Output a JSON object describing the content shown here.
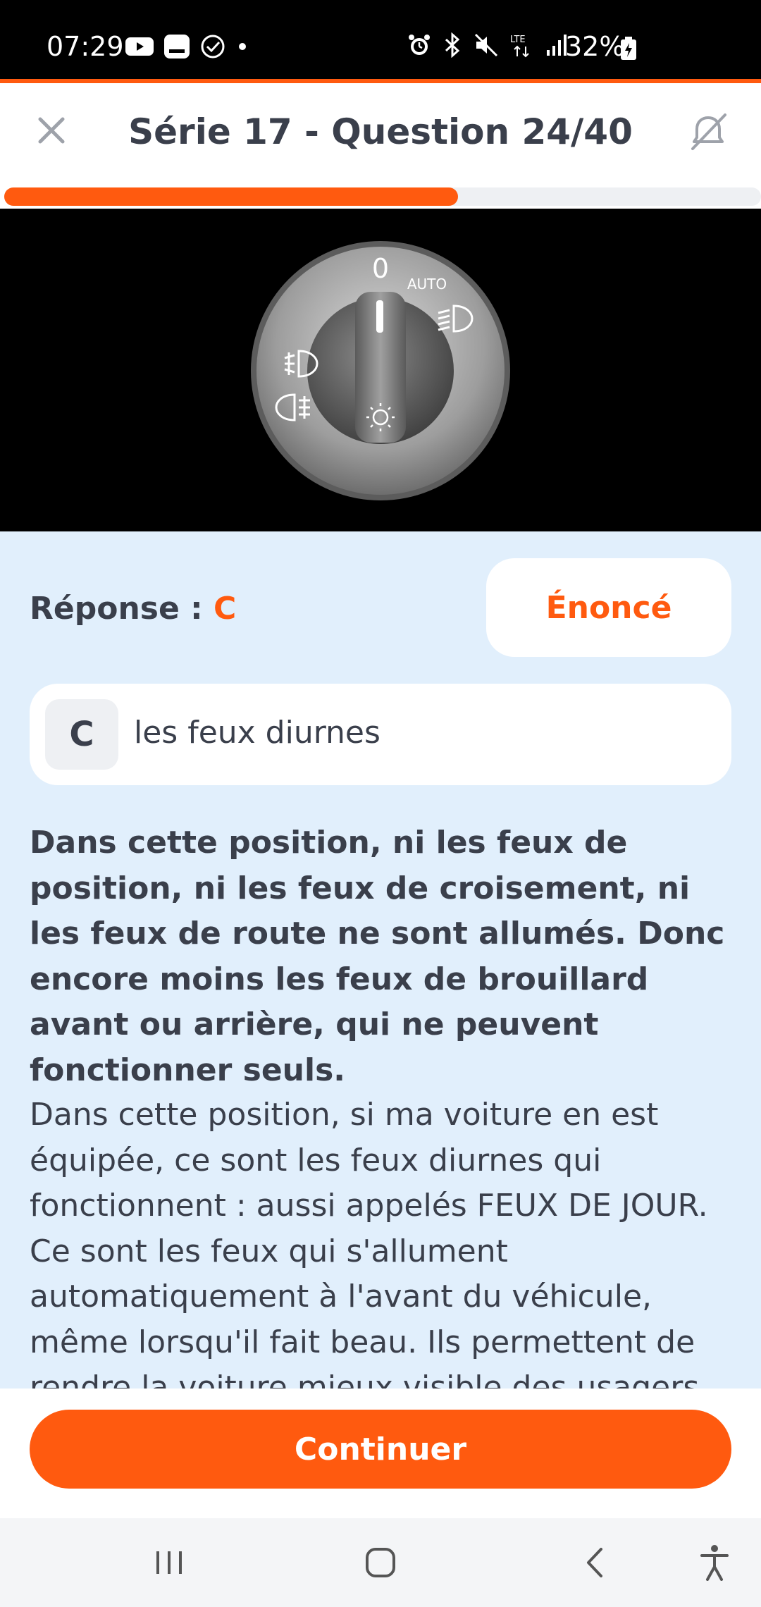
{
  "status_bar": {
    "time": "07:29",
    "battery": "32%",
    "icons_left": [
      "youtube-icon",
      "message-icon",
      "check-circle-icon",
      "dot-icon"
    ],
    "icons_right": [
      "alarm-icon",
      "bluetooth-icon",
      "mute-icon",
      "lte-icon",
      "signal-icon",
      "battery-icon"
    ]
  },
  "header": {
    "title": "Série 17 - Question 24/40",
    "close_icon": "close-icon",
    "sound_icon": "sound-off-icon"
  },
  "progress": {
    "current": 24,
    "total": 40,
    "fraction": 0.6
  },
  "illustration": {
    "dial_labels": {
      "zero": "0",
      "auto": "AUTO"
    },
    "icons": [
      "headlight-icon",
      "front-fog-light-icon",
      "rear-fog-light-icon",
      "daytime-light-icon"
    ]
  },
  "answer": {
    "label": "Réponse : ",
    "letter": "C"
  },
  "enonce_label": "Énoncé",
  "choice": {
    "letter": "C",
    "text": "les feux diurnes"
  },
  "explanation": {
    "bold": "Dans cette position, ni les feux de position, ni les feux de croisement, ni les feux de route ne sont allumés. Donc encore moins les feux de brouillard avant ou arrière, qui ne peuvent fonctionner seuls.",
    "text": "Dans cette position, si ma voiture en est équipée, ce sont les feux diurnes qui fonctionnent : aussi appelés FEUX DE JOUR. Ce sont les feux qui s'allument automatiquement à l'avant du véhicule, même lorsqu'il fait beau. Ils permettent de rendre la voiture mieux visible des usagers arrivant en face ou de ceux"
  },
  "continue_label": "Continuer",
  "colors": {
    "accent": "#ff5a0f",
    "content_bg": "#e1effc",
    "text": "#3a3f4b"
  }
}
